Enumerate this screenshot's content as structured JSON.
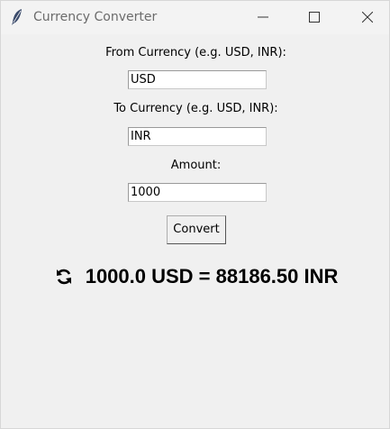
{
  "window": {
    "title": "Currency Converter",
    "app_icon": "feather-icon"
  },
  "form": {
    "from_label": "From Currency (e.g. USD, INR):",
    "from_value": "USD",
    "to_label": "To Currency (e.g. USD, INR):",
    "to_value": "INR",
    "amount_label": "Amount:",
    "amount_value": "1000",
    "convert_label": "Convert"
  },
  "result": {
    "icon": "refresh-icon",
    "text": "1000.0 USD = 88186.50 INR"
  }
}
